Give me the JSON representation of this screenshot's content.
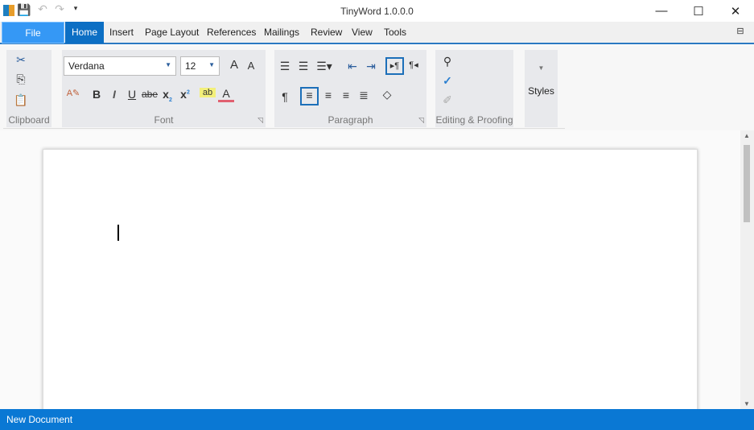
{
  "window": {
    "title": "TinyWord 1.0.0.0"
  },
  "tabs": [
    {
      "label": "File"
    },
    {
      "label": "Home"
    },
    {
      "label": "Insert"
    },
    {
      "label": "Page Layout"
    },
    {
      "label": "References"
    },
    {
      "label": "Mailings"
    },
    {
      "label": "Review"
    },
    {
      "label": "View"
    },
    {
      "label": "Tools"
    }
  ],
  "ribbon": {
    "clipboard": {
      "label": "Clipboard"
    },
    "font": {
      "label": "Font",
      "font_name": "Verdana",
      "font_size": "12",
      "strike_label": "abe"
    },
    "paragraph": {
      "label": "Paragraph"
    },
    "editing": {
      "label": "Editing & Proofing"
    },
    "styles": {
      "label": "Styles"
    }
  },
  "status": {
    "text": "New Document"
  },
  "colors": {
    "accent": "#0a78d4",
    "file_tab": "#3598f5"
  }
}
